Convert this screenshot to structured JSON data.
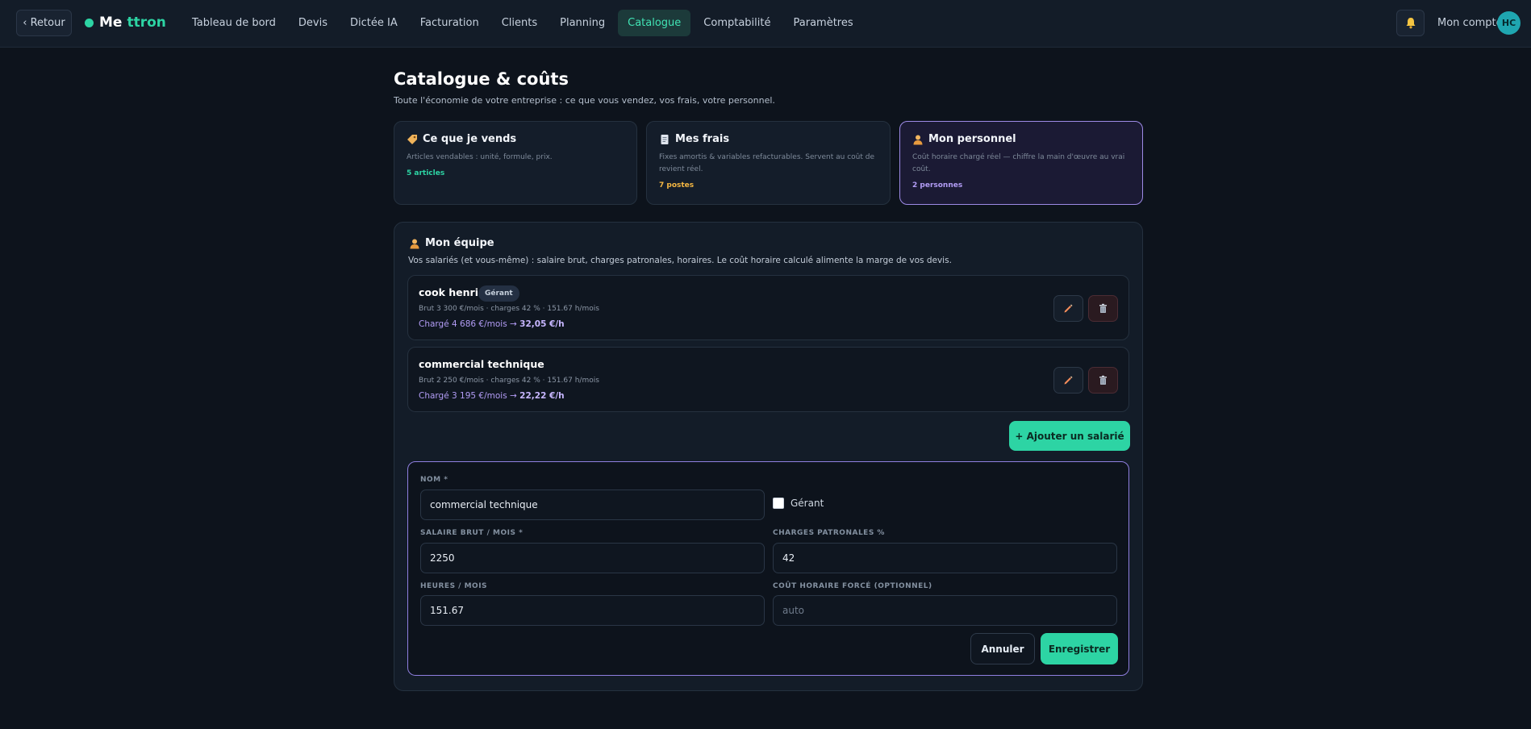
{
  "header": {
    "back_label": "‹ Retour",
    "logo_part1": "Me",
    "logo_part2": "ttron",
    "nav": [
      {
        "label": "Tableau de bord"
      },
      {
        "label": "Devis"
      },
      {
        "label": "Dictée IA"
      },
      {
        "label": "Facturation"
      },
      {
        "label": "Clients"
      },
      {
        "label": "Planning"
      },
      {
        "label": "Catalogue"
      },
      {
        "label": "Comptabilité"
      },
      {
        "label": "Paramètres"
      }
    ],
    "active_nav": "Catalogue",
    "account_label": "Mon compte",
    "avatar_initials": "HC"
  },
  "page": {
    "title": "Catalogue & coûts",
    "subtitle": "Toute l'économie de votre entreprise : ce que vous vendez, vos frais, votre personnel."
  },
  "cards": [
    {
      "title": "Ce que je vends",
      "desc": "Articles vendables : unité, formule, prix.",
      "count": "5 articles",
      "count_color": "#2dd4a4",
      "icon": "tag-icon"
    },
    {
      "title": "Mes frais",
      "desc": "Fixes amortis & variables refacturables. Servent au coût de revient réel.",
      "count": "7 postes",
      "count_color": "#f5b742",
      "icon": "receipt-icon"
    },
    {
      "title": "Mon personnel",
      "desc": "Coût horaire chargé réel — chiffre la main d'œuvre au vrai coût.",
      "count": "2 personnes",
      "count_color": "#b29cf5",
      "icon": "person-icon"
    }
  ],
  "team": {
    "title": "Mon équipe",
    "desc": "Vos salariés (et vous-même) : salaire brut, charges patronales, horaires. Le coût horaire calculé alimente la marge de vos devis.",
    "employees": [
      {
        "name": "cook henri",
        "badge": "Gérant",
        "details": "Brut 3 300 €/mois · charges 42 % · 151.67 h/mois",
        "cost_prefix": "Chargé 4 686 €/mois → ",
        "cost_rate": "32,05 €/h"
      },
      {
        "name": "commercial technique",
        "badge": "",
        "details": "Brut 2 250 €/mois · charges 42 % · 151.67 h/mois",
        "cost_prefix": "Chargé 3 195 €/mois → ",
        "cost_rate": "22,22 €/h"
      }
    ],
    "add_label": "+ Ajouter un salarié"
  },
  "form": {
    "name_label": "NOM *",
    "name_value": "commercial technique",
    "manager_label": "Gérant",
    "salary_label": "SALAIRE BRUT / MOIS *",
    "salary_value": "2250",
    "charges_label": "CHARGES PATRONALES %",
    "charges_value": "42",
    "hours_label": "HEURES / MOIS",
    "hours_value": "151.67",
    "forced_rate_label": "COÛT HORAIRE FORCÉ (OPTIONNEL)",
    "forced_rate_placeholder": "auto",
    "cancel_label": "Annuler",
    "save_label": "Enregistrer"
  }
}
